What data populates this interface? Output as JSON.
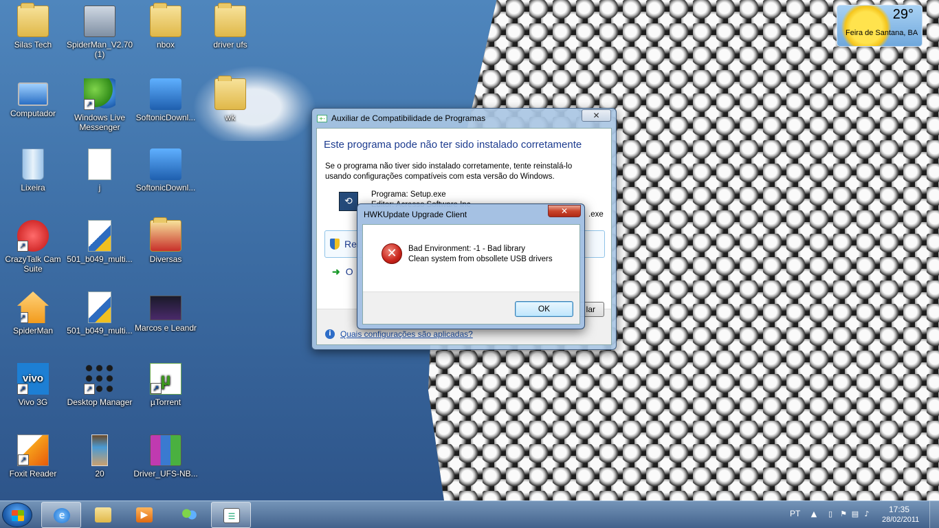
{
  "desktop": {
    "icons": [
      {
        "label": "Silas Tech",
        "icon": "user-folder-icon"
      },
      {
        "label": "SpiderMan_V2.70 (1)",
        "icon": "installer-icon"
      },
      {
        "label": "nbox",
        "icon": "folder-icon"
      },
      {
        "label": "driver ufs",
        "icon": "folder-icon"
      },
      {
        "label": "Computador",
        "icon": "computer-icon"
      },
      {
        "label": "Windows Live Messenger",
        "icon": "messenger-icon"
      },
      {
        "label": "SoftonicDownl...",
        "icon": "installer-icon"
      },
      {
        "label": "wk",
        "icon": "folder-icon"
      },
      {
        "label": "Lixeira",
        "icon": "recycle-bin-icon"
      },
      {
        "label": "j",
        "icon": "text-file-icon"
      },
      {
        "label": "SoftonicDownl...",
        "icon": "installer-icon"
      },
      {
        "label": "CrazyTalk Cam Suite",
        "icon": "crazytalk-icon"
      },
      {
        "label": "501_b049_multi...",
        "icon": "setup-file-icon"
      },
      {
        "label": "Diversas",
        "icon": "folder-icon"
      },
      {
        "label": "SpiderMan",
        "icon": "home-icon"
      },
      {
        "label": "501_b049_multi...",
        "icon": "setup-file-icon"
      },
      {
        "label": "Marcos e Leandr",
        "icon": "video-file-icon"
      },
      {
        "label": "Vivo 3G",
        "icon": "vivo-icon"
      },
      {
        "label": "Desktop Manager",
        "icon": "blackberry-icon"
      },
      {
        "label": "µTorrent",
        "icon": "utorrent-icon"
      },
      {
        "label": "Foxit Reader",
        "icon": "foxit-icon"
      },
      {
        "label": "20",
        "icon": "image-file-icon"
      },
      {
        "label": "Driver_UFS-NB...",
        "icon": "winrar-icon"
      }
    ]
  },
  "weather": {
    "temperature": "29°",
    "city": "Feira de Santana, BA"
  },
  "compat_window": {
    "title": "Auxiliar de Compatibilidade de Programas",
    "heading": "Este programa pode não ter sido instalado corretamente",
    "description": "Se o programa não tiver sido instalado corretamente, tente reinstalá-lo usando configurações compatíveis com esta versão do Windows.",
    "program_line": "Programa: Setup.exe",
    "editor_line": "Editor: Acresso Software Inc",
    "path_tail": ".exe",
    "option1_label": "Rei",
    "option2_label": "O",
    "cancel_label": "lar",
    "link_text": "Quais configurações são aplicadas?",
    "close_label": "✕"
  },
  "error_dialog": {
    "title": "HWKUpdate Upgrade Client",
    "line1": "Bad Environment: -1 - Bad library",
    "line2": "Clean system from obsollete USB drivers",
    "ok_label": "OK",
    "close_label": "✕"
  },
  "taskbar": {
    "language": "PT",
    "time": "17:35",
    "date": "28/02/2011",
    "pinned": [
      {
        "icon": "internet-explorer-icon",
        "active": true
      },
      {
        "icon": "windows-explorer-icon",
        "active": false
      },
      {
        "icon": "media-player-icon",
        "active": false
      },
      {
        "icon": "windows-live-messenger-icon",
        "active": false
      },
      {
        "icon": "program-compat-icon",
        "active": true
      }
    ]
  }
}
